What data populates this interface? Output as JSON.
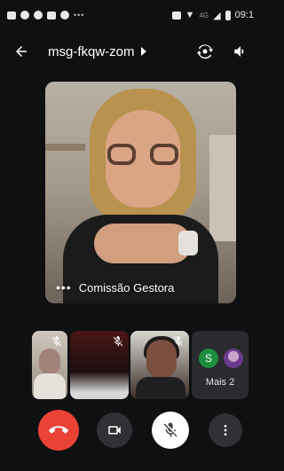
{
  "status_bar": {
    "signal_text": "4G",
    "time": "09:1"
  },
  "app_bar": {
    "meeting_code": "msg-fkqw-zom"
  },
  "main_tile": {
    "participant_name": "Comissão Gestora"
  },
  "thumbnails": {
    "more_label": "Mais 2",
    "avatar_initial": "S"
  },
  "colors": {
    "end_call": "#ea4335",
    "avatar_green": "#1e8e3e",
    "background": "#0f1012"
  },
  "icons": {
    "back": "arrow-left-icon",
    "switch_camera": "switch-camera-icon",
    "speaker": "speaker-icon",
    "more": "more-vert-icon",
    "mic_off": "mic-off-icon",
    "camera": "video-camera-icon",
    "end_call": "phone-hangup-icon"
  }
}
